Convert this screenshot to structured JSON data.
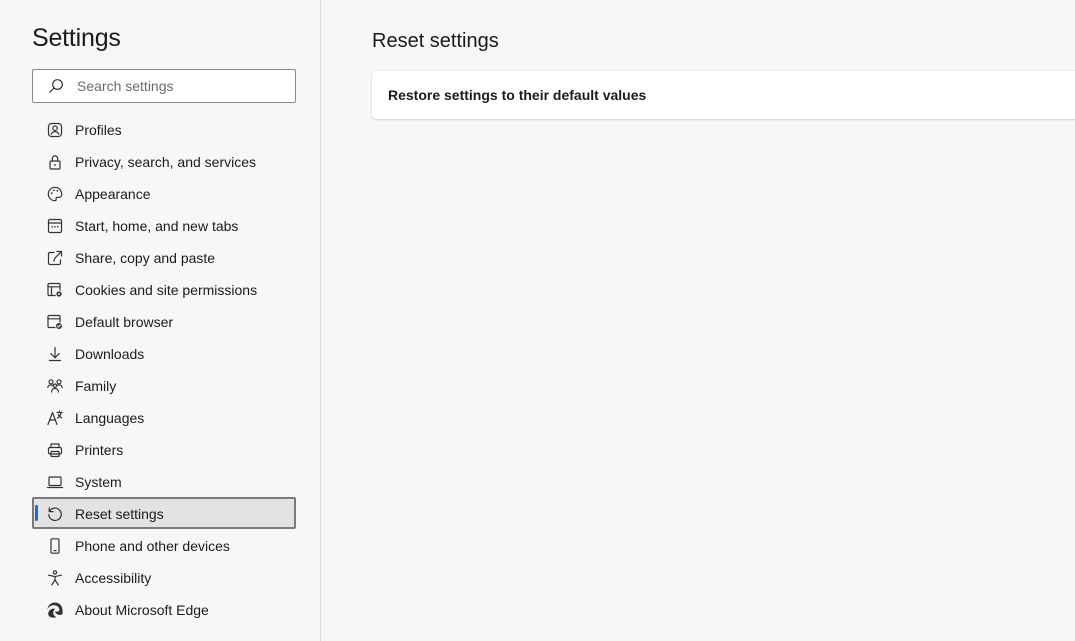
{
  "sidebar": {
    "title": "Settings",
    "search": {
      "placeholder": "Search settings",
      "value": ""
    },
    "active_index": 12,
    "items": [
      {
        "label": "Profiles",
        "icon": "profile-icon"
      },
      {
        "label": "Privacy, search, and services",
        "icon": "lock-icon"
      },
      {
        "label": "Appearance",
        "icon": "palette-icon"
      },
      {
        "label": "Start, home, and new tabs",
        "icon": "start-page-icon"
      },
      {
        "label": "Share, copy and paste",
        "icon": "share-icon"
      },
      {
        "label": "Cookies and site permissions",
        "icon": "cookies-permissions-icon"
      },
      {
        "label": "Default browser",
        "icon": "default-browser-icon"
      },
      {
        "label": "Downloads",
        "icon": "download-icon"
      },
      {
        "label": "Family",
        "icon": "family-icon"
      },
      {
        "label": "Languages",
        "icon": "languages-icon"
      },
      {
        "label": "Printers",
        "icon": "printer-icon"
      },
      {
        "label": "System",
        "icon": "laptop-icon"
      },
      {
        "label": "Reset settings",
        "icon": "reset-icon"
      },
      {
        "label": "Phone and other devices",
        "icon": "phone-icon"
      },
      {
        "label": "Accessibility",
        "icon": "accessibility-icon"
      },
      {
        "label": "About Microsoft Edge",
        "icon": "edge-logo-icon"
      }
    ]
  },
  "main": {
    "title": "Reset settings",
    "card": {
      "label": "Restore settings to their default values"
    }
  },
  "colors": {
    "accent": "#1a6fc7",
    "background": "#f7f7f7",
    "active_item": "#e2e2e2"
  }
}
